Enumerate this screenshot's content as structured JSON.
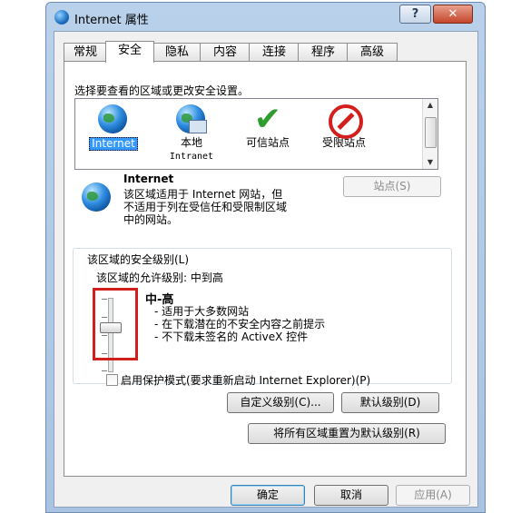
{
  "window": {
    "title": "Internet 属性"
  },
  "titlebar": {
    "help_label": "?",
    "close_label": "✕"
  },
  "tabs": [
    "常规",
    "安全",
    "隐私",
    "内容",
    "连接",
    "程序",
    "高级"
  ],
  "active_tab": "安全",
  "zones_prompt": "选择要查看的区域或更改安全设置。",
  "zones": [
    {
      "label": "Internet",
      "icon": "globe-icon"
    },
    {
      "label": "本地",
      "label2": "Intranet",
      "icon": "local-intranet-icon"
    },
    {
      "label": "可信站点",
      "icon": "checkmark-icon"
    },
    {
      "label": "受限站点",
      "icon": "no-entry-icon"
    }
  ],
  "zone_detail": {
    "title": "Internet",
    "desc_lines": [
      "该区域适用于 Internet 网站，但",
      "不适用于列在受信任和受限制区域",
      "中的网站。"
    ],
    "sites_button": "站点(S)"
  },
  "security_level": {
    "group_label": "该区域的安全级别(L)",
    "allowed_label": "该区域的允许级别: 中到高",
    "level_name": "中-高",
    "bullets": [
      "- 适用于大多数网站",
      "- 在下载潜在的不安全内容之前提示",
      "- 不下载未签名的 ActiveX 控件"
    ],
    "slider_level": "中-高"
  },
  "protected_mode": {
    "label": "启用保护模式(要求重新启动 Internet Explorer)(P)",
    "checked": false
  },
  "buttons": {
    "custom_level": "自定义级别(C)...",
    "default_level": "默认级别(D)",
    "reset_all": "将所有区域重置为默认级别(R)",
    "ok": "确定",
    "cancel": "取消",
    "apply": "应用(A)"
  },
  "colors": {
    "selection": "#3399ff",
    "highlight_box": "#d0201c"
  }
}
